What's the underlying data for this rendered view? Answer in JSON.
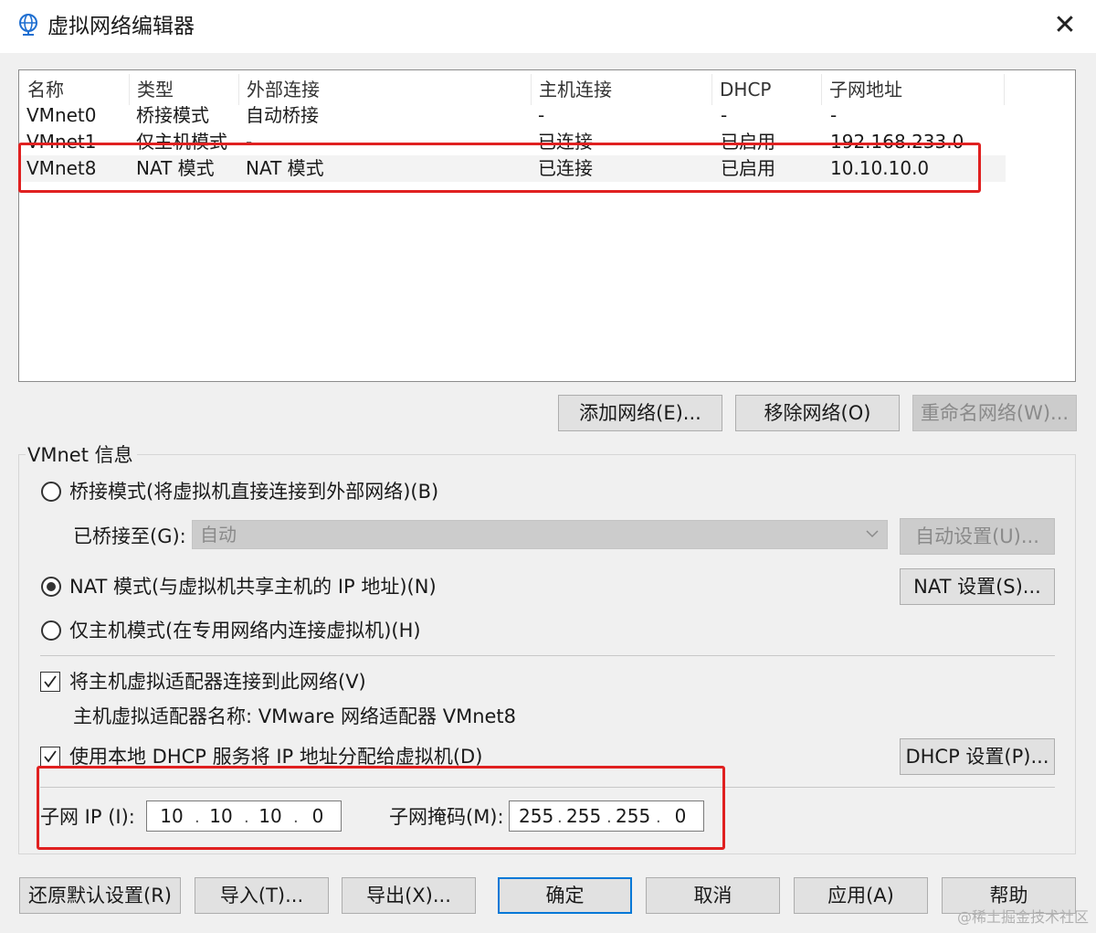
{
  "window": {
    "title": "虚拟网络编辑器",
    "close_glyph": "✕",
    "icon": "globe-network-icon"
  },
  "network_list": {
    "columns": [
      "名称",
      "类型",
      "外部连接",
      "主机连接",
      "DHCP",
      "子网地址"
    ],
    "rows": [
      {
        "name": "VMnet0",
        "type": "桥接模式",
        "external": "自动桥接",
        "host": "-",
        "dhcp": "-",
        "subnet": "-",
        "selected": false
      },
      {
        "name": "VMnet1",
        "type": "仅主机模式",
        "external": "-",
        "host": "已连接",
        "dhcp": "已启用",
        "subnet": "192.168.233.0",
        "selected": false
      },
      {
        "name": "VMnet8",
        "type": "NAT 模式",
        "external": "NAT 模式",
        "host": "已连接",
        "dhcp": "已启用",
        "subnet": "10.10.10.0",
        "selected": true
      }
    ]
  },
  "list_buttons": {
    "add": "添加网络(E)...",
    "remove": "移除网络(O)",
    "rename": "重命名网络(W)..."
  },
  "vmnet_info": {
    "title": "VMnet 信息",
    "bridge_mode": "桥接模式(将虚拟机直接连接到外部网络)(B)",
    "bridged_to_label": "已桥接至(G):",
    "bridged_to_value": "自动",
    "auto_settings": "自动设置(U)...",
    "nat_mode": "NAT 模式(与虚拟机共享主机的 IP 地址)(N)",
    "nat_settings": "NAT 设置(S)...",
    "host_only_mode": "仅主机模式(在专用网络内连接虚拟机)(H)",
    "selected_mode": "nat",
    "connect_adapter": "将主机虚拟适配器连接到此网络(V)",
    "connect_adapter_checked": true,
    "adapter_name": "主机虚拟适配器名称: VMware 网络适配器 VMnet8",
    "use_dhcp": "使用本地 DHCP 服务将 IP 地址分配给虚拟机(D)",
    "use_dhcp_checked": true,
    "dhcp_settings": "DHCP 设置(P)...",
    "subnet_ip_label": "子网 IP (I):",
    "subnet_ip": [
      "10",
      "10",
      "10",
      "0"
    ],
    "subnet_mask_label": "子网掩码(M):",
    "subnet_mask": [
      "255",
      "255",
      "255",
      "0"
    ]
  },
  "footer_buttons": {
    "restore": "还原默认设置(R)",
    "import": "导入(T)...",
    "export": "导出(X)...",
    "ok": "确定",
    "cancel": "取消",
    "apply": "应用(A)",
    "help": "帮助"
  },
  "watermark": "@稀土掘金技术社区",
  "colors": {
    "highlight_box": "#e02020",
    "primary_border": "#0078d7"
  }
}
